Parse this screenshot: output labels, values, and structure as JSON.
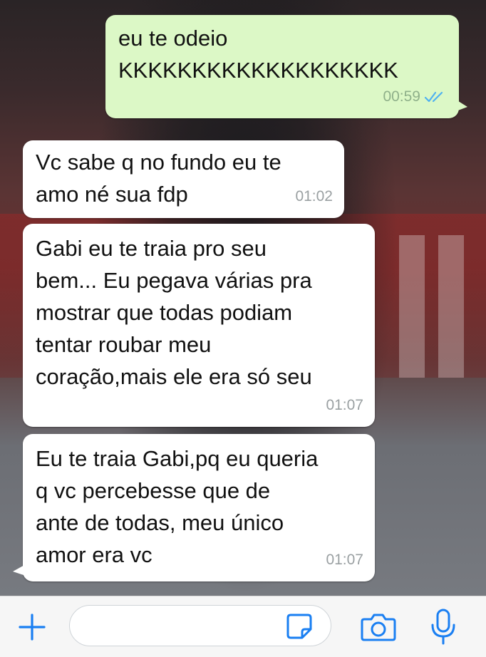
{
  "messages": [
    {
      "text": "eu te odeio\nKKKKKKKKKKKKKKKKKKK",
      "time": "00:59",
      "direction": "outgoing",
      "status": "delivered"
    },
    {
      "text": "Vc sabe q no fundo eu te\namo né sua fdp",
      "time": "01:02",
      "direction": "incoming"
    },
    {
      "text": "Gabi eu te traia pro seu\nbem... Eu pegava várias pra\nmostrar que todas podiam\ntentar roubar meu\ncoração,mais ele era só seu",
      "time": "01:07",
      "direction": "incoming"
    },
    {
      "text": "Eu te traia Gabi,pq eu queria\nq vc percebesse que de\nante de todas, meu único\namor era vc",
      "time": "01:07",
      "direction": "incoming"
    }
  ],
  "composer": {
    "value": "",
    "placeholder": ""
  },
  "icons": {
    "attach": "plus-icon",
    "sticker": "sticker-icon",
    "camera": "camera-icon",
    "mic": "microphone-icon",
    "status": "double-check-icon"
  },
  "colors": {
    "outgoing_bubble": "#dcf8c6",
    "incoming_bubble": "#ffffff",
    "accent": "#1a7ff2",
    "tick": "#4fb1f0"
  }
}
